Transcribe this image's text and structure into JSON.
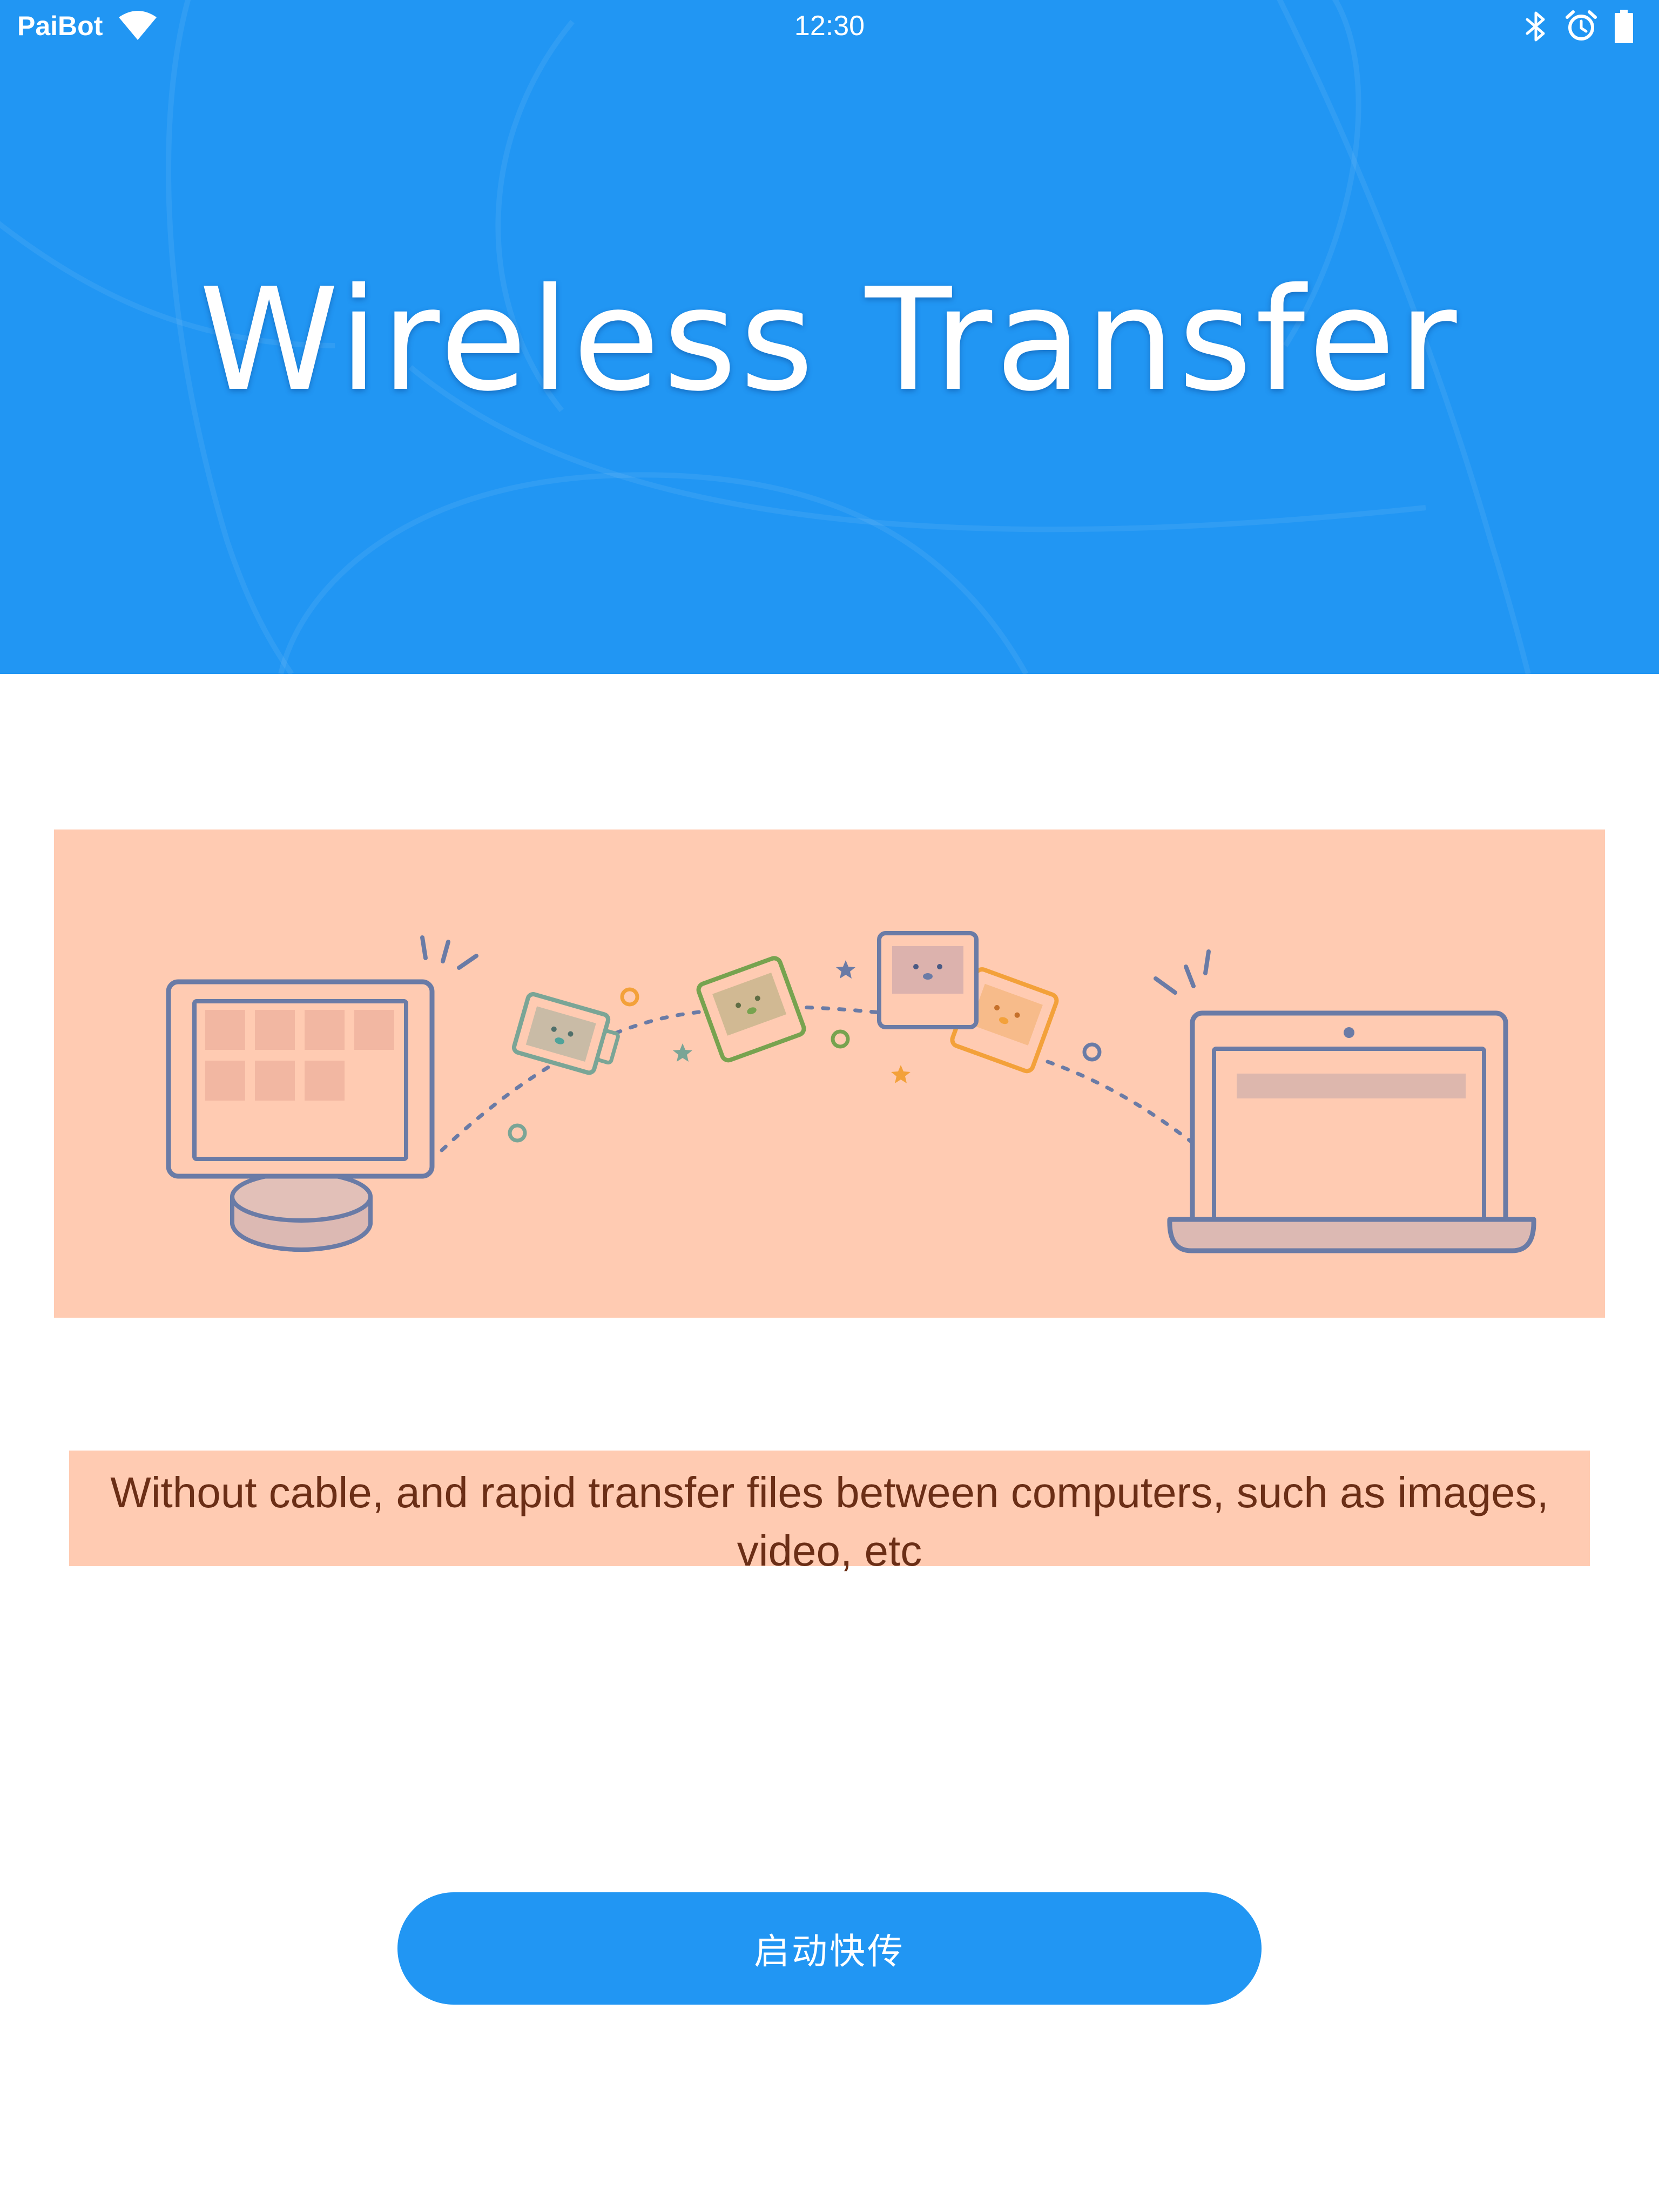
{
  "status_bar": {
    "carrier": "PaiBot",
    "time": "12:30",
    "icons": [
      "wifi-icon",
      "bluetooth-icon",
      "alarm-icon",
      "battery-icon"
    ]
  },
  "header": {
    "title": "Wireless Transfer",
    "background_color": "#2196f3"
  },
  "illustration": {
    "background_color": "#ffcbb2",
    "elements": [
      "desktop-monitor",
      "photo-card",
      "laptop",
      "dotted-transfer-path"
    ]
  },
  "description": {
    "text": "Without cable, and rapid transfer files between computers, such as images, video, etc",
    "text_color": "#6b2e16",
    "background_color": "#ffcbb2"
  },
  "action": {
    "start_label": "启动快传",
    "color": "#2196f3"
  }
}
